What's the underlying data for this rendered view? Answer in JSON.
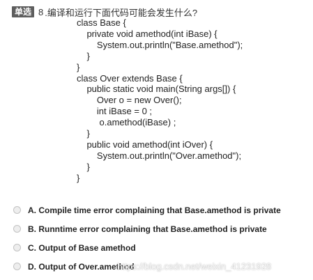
{
  "question": {
    "type_badge": "单选",
    "number": "8",
    "text": ".编译和运行下面代码可能会发生什么?"
  },
  "code_lines": [
    "class Base {",
    "    private void amethod(int iBase) {",
    "        System.out.println(\"Base.amethod\");",
    "    }",
    "}",
    "class Over extends Base {",
    "    public static void main(String args[]) {",
    "        Over o = new Over();",
    "        int iBase = 0 ;",
    "         o.amethod(iBase) ;",
    "    }",
    "    public void amethod(int iOver) {",
    "        System.out.println(\"Over.amethod\");",
    "    }",
    "}"
  ],
  "options": [
    {
      "label": "A. Compile time error complaining that Base.amethod is private",
      "selected": false
    },
    {
      "label": "B. Runntime error complaining that Base.amethod is private",
      "selected": false
    },
    {
      "label": "C. Output of Base amethod",
      "selected": false
    },
    {
      "label": "D. Output of Over.amethod",
      "selected": false
    }
  ],
  "watermark": "https://blog.csdn.net/weixin_41231928",
  "colors": {
    "badge_background": "#5e5e5e",
    "badge_text": "#ffffff",
    "text": "#222222",
    "radio_border": "#c2c2c2",
    "radio_fill": "#eeeeee"
  }
}
